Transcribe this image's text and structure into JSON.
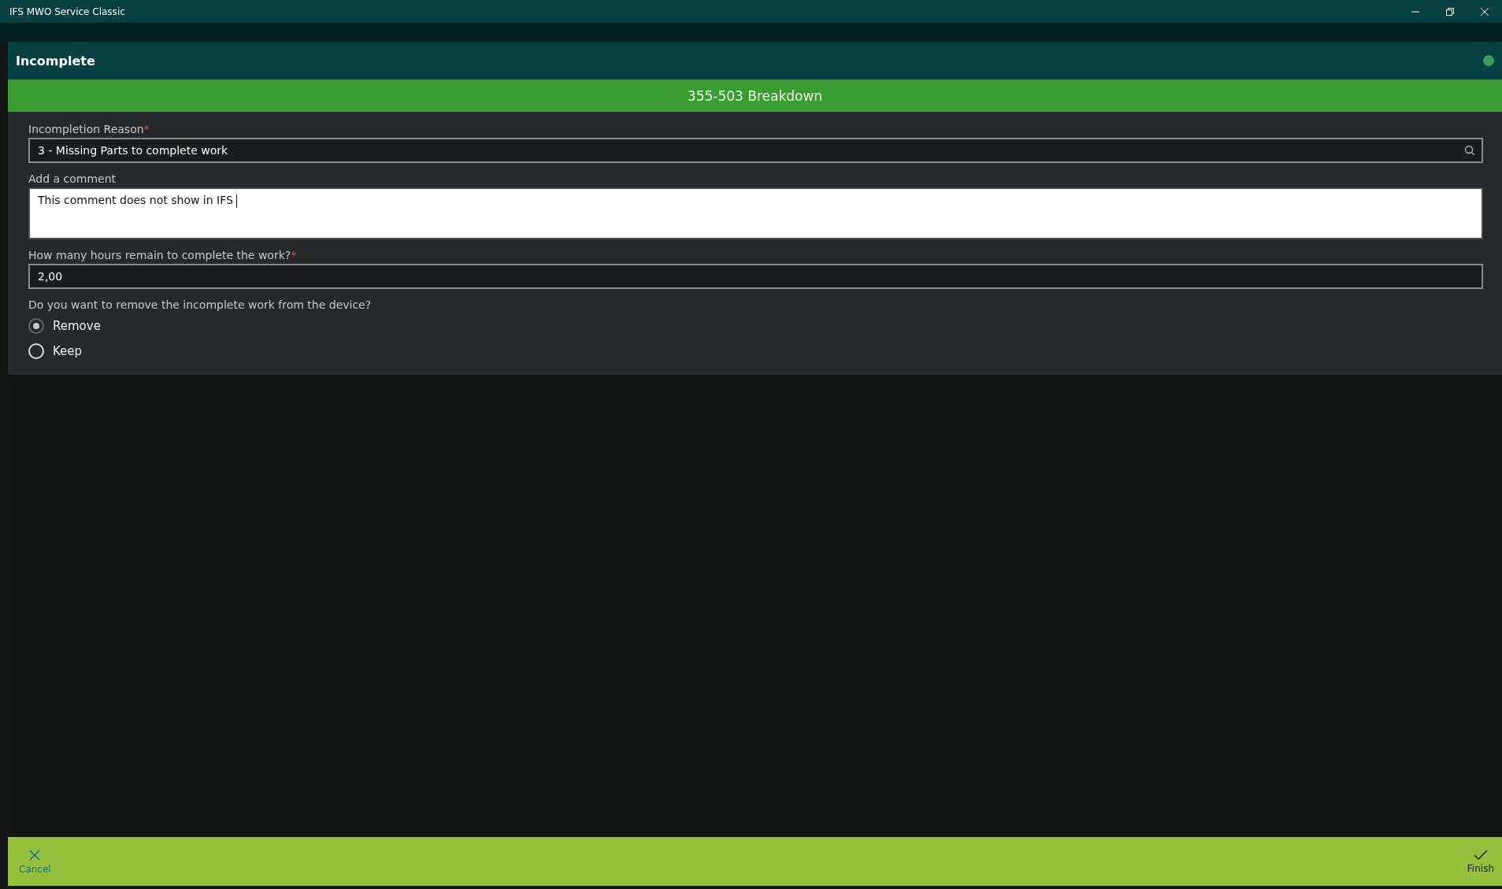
{
  "window": {
    "title": "IFS MWO Service Classic"
  },
  "dialog": {
    "title": "Incomplete",
    "status_on": true
  },
  "banner": "355-503 Breakdown",
  "form": {
    "reason": {
      "label": "Incompletion Reason",
      "required_mark": "*",
      "value": "3 - Missing Parts to complete work"
    },
    "comment": {
      "label": "Add a comment",
      "value": "This comment does not show in IFS "
    },
    "hours": {
      "label": "How many hours remain to complete the work?",
      "required_mark": "*",
      "value": "2,00"
    },
    "question": "Do you want to remove the incomplete work from the device?",
    "options": [
      {
        "label": "Remove",
        "selected": true
      },
      {
        "label": "Keep",
        "selected": false
      }
    ]
  },
  "actions": {
    "cancel": "Cancel",
    "finish": "Finish"
  }
}
